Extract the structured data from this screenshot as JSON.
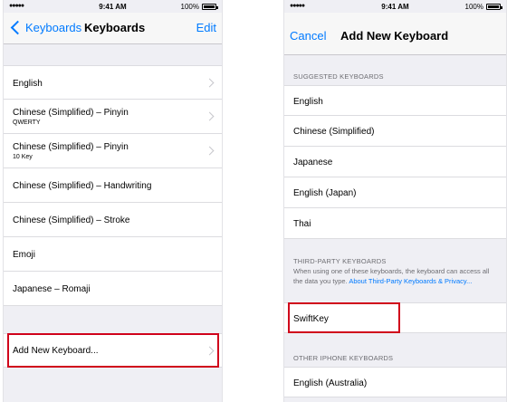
{
  "left": {
    "status": {
      "signal": "●●●●● ",
      "time": "9:41 AM",
      "battery": "100%"
    },
    "nav": {
      "back": "Keyboards",
      "title": "Keyboards",
      "edit": "Edit"
    },
    "rows": [
      {
        "label": "English",
        "sub": ""
      },
      {
        "label": "Chinese (Simplified) – Pinyin",
        "sub": "QWERTY"
      },
      {
        "label": "Chinese (Simplified) – Pinyin",
        "sub": "10 Key"
      },
      {
        "label": "Chinese (Simplified) – Handwriting",
        "sub": ""
      },
      {
        "label": "Chinese (Simplified) – Stroke",
        "sub": ""
      },
      {
        "label": "Emoji",
        "sub": ""
      },
      {
        "label": "Japanese – Romaji",
        "sub": ""
      }
    ],
    "add": "Add New Keyboard..."
  },
  "right": {
    "status": {
      "signal": "●●●●● ",
      "time": "9:41 AM",
      "battery": "100%"
    },
    "nav": {
      "cancel": "Cancel",
      "title": "Add New Keyboard"
    },
    "suggested_header": "SUGGESTED KEYBOARDS",
    "suggested": [
      "English",
      "Chinese (Simplified)",
      "Japanese",
      "English (Japan)",
      "Thai"
    ],
    "third_party_header": "THIRD-PARTY KEYBOARDS",
    "third_party_note": "When using one of these keyboards, the keyboard can access all the data you type.",
    "third_party_link": "About Third-Party Keyboards & Privacy...",
    "third_party": [
      "SwiftKey"
    ],
    "other_header": "OTHER IPHONE KEYBOARDS",
    "other": [
      "English (Australia)"
    ]
  },
  "colors": {
    "accent": "#007aff",
    "highlight": "#d0021b",
    "background": "#efeff4"
  }
}
